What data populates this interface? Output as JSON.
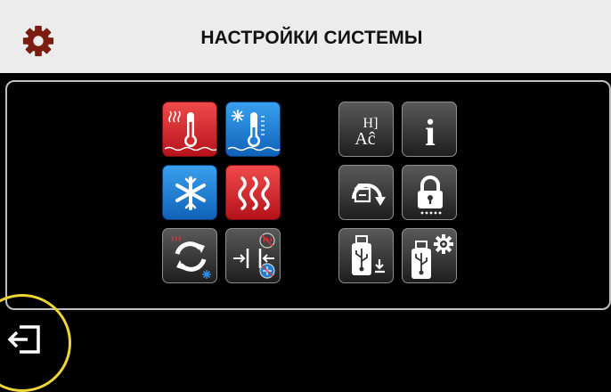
{
  "header": {
    "title": "НАСТРОЙКИ СИСТЕМЫ",
    "icon": "gear-icon"
  },
  "colors": {
    "header_bg": "#ececec",
    "red": "#d42a2f",
    "blue": "#1d7fd6",
    "dark": "#333333",
    "highlight_ring": "#ecd636"
  },
  "left_grid": [
    {
      "name": "heating-temperature-button",
      "icon": "heat-thermometer-icon",
      "style": "red"
    },
    {
      "name": "cooling-temperature-button",
      "icon": "cold-thermometer-icon",
      "style": "blue"
    },
    {
      "name": "cooling-mode-button",
      "icon": "snowflake-icon",
      "style": "blue"
    },
    {
      "name": "heating-mode-button",
      "icon": "heat-waves-icon",
      "style": "red"
    },
    {
      "name": "heat-cool-cycle-button",
      "icon": "heat-cool-cycle-icon",
      "style": "dark"
    },
    {
      "name": "defrost-settings-button",
      "icon": "defrost-icon",
      "style": "dark"
    }
  ],
  "right_grid": [
    {
      "name": "language-button",
      "icon": "language-icon",
      "style": "dark"
    },
    {
      "name": "info-button",
      "icon": "info-icon",
      "style": "dark"
    },
    {
      "name": "factory-reset-button",
      "icon": "reset-icon",
      "style": "dark"
    },
    {
      "name": "lock-button",
      "icon": "lock-icon",
      "style": "dark"
    },
    {
      "name": "usb-download-button",
      "icon": "usb-download-icon",
      "style": "dark"
    },
    {
      "name": "usb-settings-button",
      "icon": "usb-settings-icon",
      "style": "dark"
    }
  ],
  "footer": {
    "exit_icon": "exit-icon"
  },
  "language_glyphs": {
    "top": "Н]",
    "bottom": "Aĉ"
  },
  "info_glyph": "i"
}
